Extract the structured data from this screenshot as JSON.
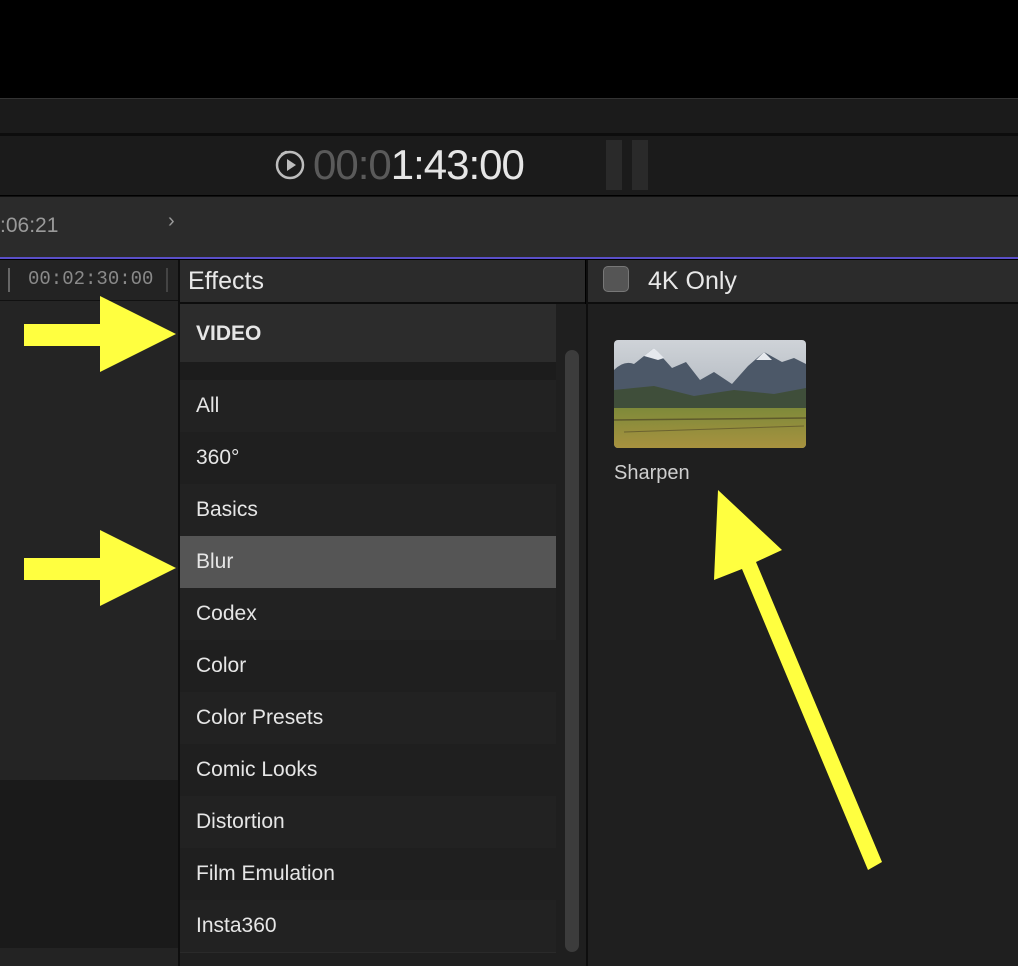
{
  "viewer": {
    "timecode_dim": "00:0",
    "timecode_bright": "1:43:00",
    "play_icon": "play-clock-icon"
  },
  "timeline": {
    "ruler_time": ":06:21",
    "ruler_arrow": "›",
    "left_timecode": "00:02:30:00"
  },
  "effects": {
    "title": "Effects",
    "section_header": "VIDEO",
    "categories": [
      "All",
      "360°",
      "Basics",
      "Blur",
      "Codex",
      "Color",
      "Color Presets",
      "Comic Looks",
      "Distortion",
      "Film Emulation",
      "Insta360"
    ],
    "selected": "Blur"
  },
  "browser": {
    "filter_label": "4K Only",
    "filter_checked": false,
    "items": [
      {
        "name": "Sharpen",
        "thumbnail": "mountain-landscape-thumbnail"
      }
    ]
  },
  "annotations": {
    "arrow_color": "#ffff40"
  }
}
